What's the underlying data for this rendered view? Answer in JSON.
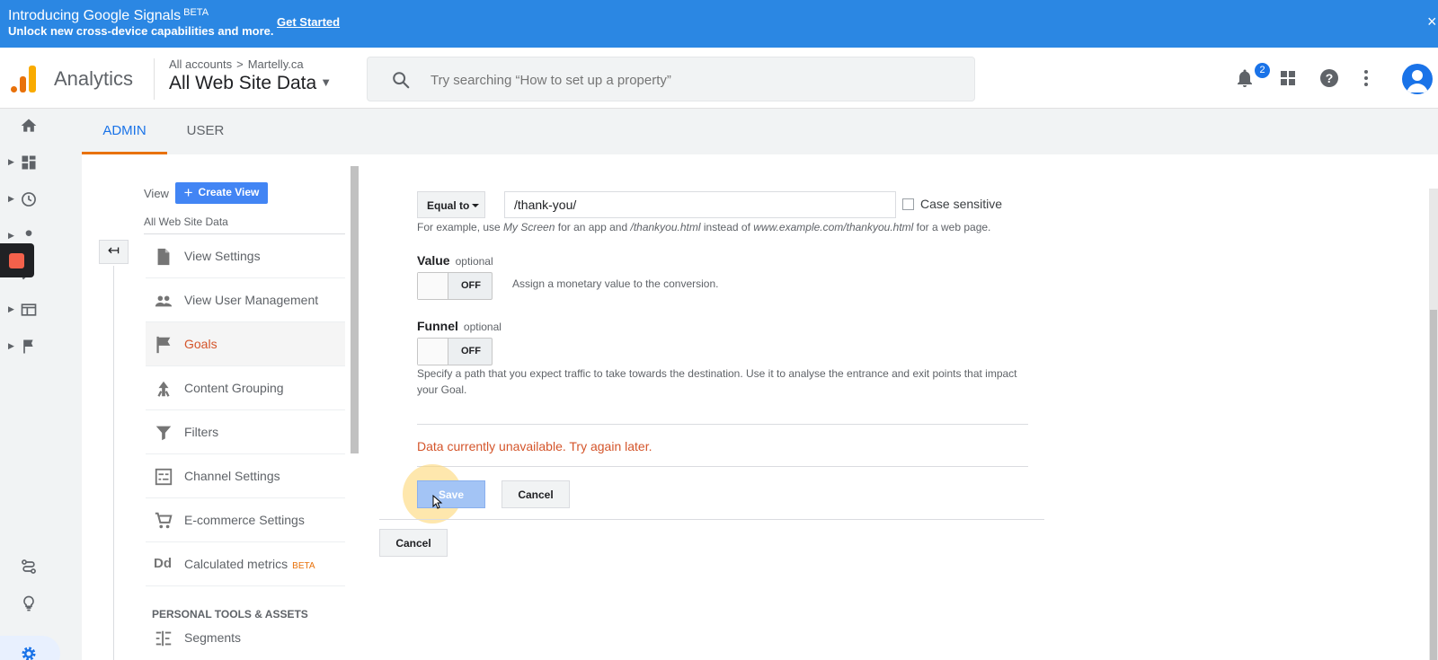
{
  "banner": {
    "title": "Introducing Google Signals",
    "beta": "BETA",
    "subtitle": "Unlock new cross-device capabilities and more.",
    "link": "Get Started",
    "close": "×"
  },
  "header": {
    "app_name": "Analytics",
    "breadcrumb": [
      "All accounts",
      ">",
      "Martelly.ca"
    ],
    "property": "All Web Site Data",
    "search_placeholder": "Try searching “How to set up a property”",
    "notification_count": "2",
    "icons": [
      "notifications-icon",
      "apps-icon",
      "help-icon",
      "more-icon",
      "account-icon"
    ]
  },
  "tabs": [
    {
      "label": "ADMIN",
      "active": true
    },
    {
      "label": "USER",
      "active": false
    }
  ],
  "nav": {
    "view_label": "View",
    "create_view": "Create View",
    "view_name": "All Web Site Data",
    "items": [
      {
        "label": "View Settings",
        "icon": "document-icon"
      },
      {
        "label": "View User Management",
        "icon": "people-icon"
      },
      {
        "label": "Goals",
        "icon": "flag-icon",
        "active": true
      },
      {
        "label": "Content Grouping",
        "icon": "content-grouping-icon"
      },
      {
        "label": "Filters",
        "icon": "filter-icon"
      },
      {
        "label": "Channel Settings",
        "icon": "channel-settings-icon"
      },
      {
        "label": "E-commerce Settings",
        "icon": "cart-icon"
      },
      {
        "label": "Calculated metrics",
        "icon": "dd-icon",
        "icon_text": "Dd",
        "badge": "BETA"
      },
      {
        "label": "Segments",
        "icon": "segments-icon"
      }
    ],
    "section_header": "PERSONAL TOOLS & ASSETS"
  },
  "form": {
    "match_type": "Equal to",
    "destination_value": "/thank-you/",
    "case_sensitive_label": "Case sensitive",
    "case_sensitive": false,
    "example_parts": [
      "For example, use ",
      "My Screen",
      " for an app and ",
      "/thankyou.html",
      " instead of ",
      "www.example.com/thankyou.html",
      " for a web page."
    ],
    "value_label": "Value",
    "value_optional": "optional",
    "value_toggle": "OFF",
    "value_hint": "Assign a monetary value to the conversion.",
    "funnel_label": "Funnel",
    "funnel_optional": "optional",
    "funnel_toggle": "OFF",
    "funnel_hint": "Specify a path that you expect traffic to take towards the destination. Use it to analyse the entrance and exit points that impact your Goal.",
    "error": "Data currently unavailable. Try again later.",
    "save": "Save",
    "cancel": "Cancel",
    "outer_cancel": "Cancel"
  },
  "colors": {
    "banner": "#2b87e3",
    "accent": "#1a73e8",
    "active_tab_underline": "#e8710a",
    "error": "#d4552b"
  }
}
